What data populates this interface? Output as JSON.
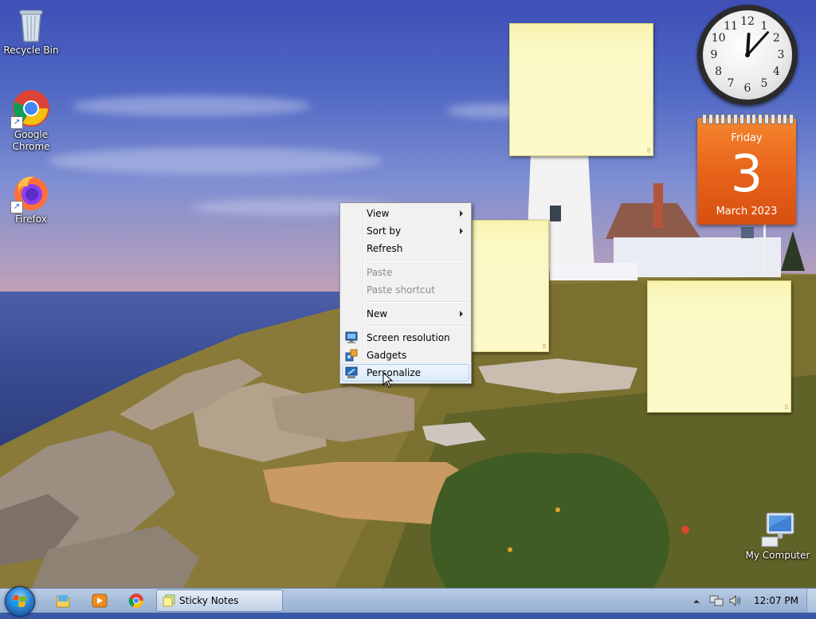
{
  "desktop": {
    "icons": [
      {
        "label": "Recycle Bin",
        "icon": "recycle-bin-icon"
      },
      {
        "label": "Google\nChrome",
        "icon": "chrome-icon"
      },
      {
        "label": "Firefox",
        "icon": "firefox-icon"
      },
      {
        "label": "My Computer",
        "icon": "computer-icon"
      }
    ]
  },
  "gadgets": {
    "clock": {
      "numbers": [
        "12",
        "1",
        "2",
        "3",
        "4",
        "5",
        "6",
        "7",
        "8",
        "9",
        "10",
        "11"
      ],
      "hour": 12,
      "minute": 7
    },
    "calendar": {
      "day_name": "Friday",
      "day_number": "3",
      "month_year": "March 2023"
    }
  },
  "context_menu": {
    "items": [
      {
        "label": "View",
        "submenu": true,
        "disabled": false
      },
      {
        "label": "Sort by",
        "submenu": true,
        "disabled": false
      },
      {
        "label": "Refresh",
        "submenu": false,
        "disabled": false
      },
      {
        "label": "Paste",
        "submenu": false,
        "disabled": true
      },
      {
        "label": "Paste shortcut",
        "submenu": false,
        "disabled": true
      },
      {
        "label": "New",
        "submenu": true,
        "disabled": false
      },
      {
        "label": "Screen resolution",
        "submenu": false,
        "disabled": false,
        "icon": "monitor-icon"
      },
      {
        "label": "Gadgets",
        "submenu": false,
        "disabled": false,
        "icon": "gadgets-icon"
      },
      {
        "label": "Personalize",
        "submenu": false,
        "disabled": false,
        "icon": "personalize-icon",
        "highlighted": true
      }
    ]
  },
  "taskbar": {
    "pinned": [
      "explorer-icon",
      "media-player-icon",
      "chrome-icon"
    ],
    "task": {
      "label": "Sticky Notes",
      "icon": "sticky-notes-icon"
    },
    "tray": {
      "time": "12:07 PM",
      "icons": [
        "show-hidden-icons-arrow",
        "network-icon",
        "volume-icon"
      ]
    }
  },
  "colors": {
    "calendar_orange": "#e8641b",
    "sticky_yellow": "#fdf9c8",
    "menu_highlight": "#dcebfc"
  }
}
